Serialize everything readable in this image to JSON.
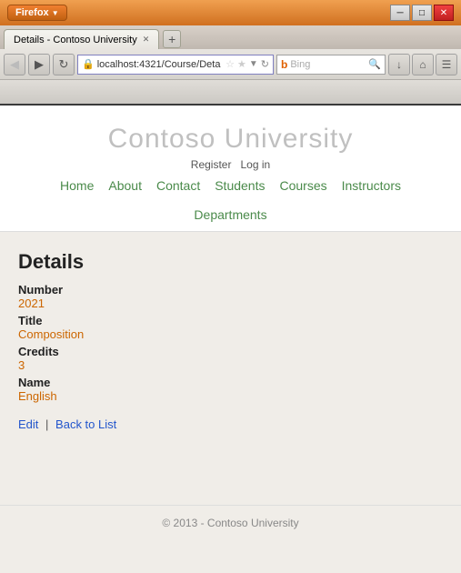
{
  "browser": {
    "title_bar": {
      "firefox_label": "Firefox",
      "min_button": "─",
      "restore_button": "□",
      "close_button": "✕"
    },
    "tab": {
      "label": "Details - Contoso University",
      "new_tab_icon": "+"
    },
    "address_bar": {
      "url": "localhost:4321/Course/Deta",
      "icon": "🔒",
      "stars": "☆★"
    },
    "search": {
      "placeholder": "Bing",
      "brand": "b"
    },
    "nav_buttons": {
      "back": "◀",
      "forward": "▶",
      "refresh": "↻",
      "home": "⌂",
      "extra": "☰"
    }
  },
  "header": {
    "site_title": "Contoso University",
    "auth_register": "Register",
    "auth_login": "Log in",
    "nav_items": [
      {
        "label": "Home",
        "href": "#"
      },
      {
        "label": "About",
        "href": "#"
      },
      {
        "label": "Contact",
        "href": "#"
      },
      {
        "label": "Students",
        "href": "#"
      },
      {
        "label": "Courses",
        "href": "#"
      },
      {
        "label": "Instructors",
        "href": "#"
      },
      {
        "label": "Departments",
        "href": "#"
      }
    ]
  },
  "details": {
    "heading": "Details",
    "fields": [
      {
        "label": "Number",
        "value": "2021"
      },
      {
        "label": "Title",
        "value": "Composition"
      },
      {
        "label": "Credits",
        "value": "3"
      },
      {
        "label": "Name",
        "value": "English"
      }
    ],
    "edit_link": "Edit",
    "separator": "|",
    "back_link": "Back to List"
  },
  "footer": {
    "copyright": "© 2013 - Contoso University"
  }
}
